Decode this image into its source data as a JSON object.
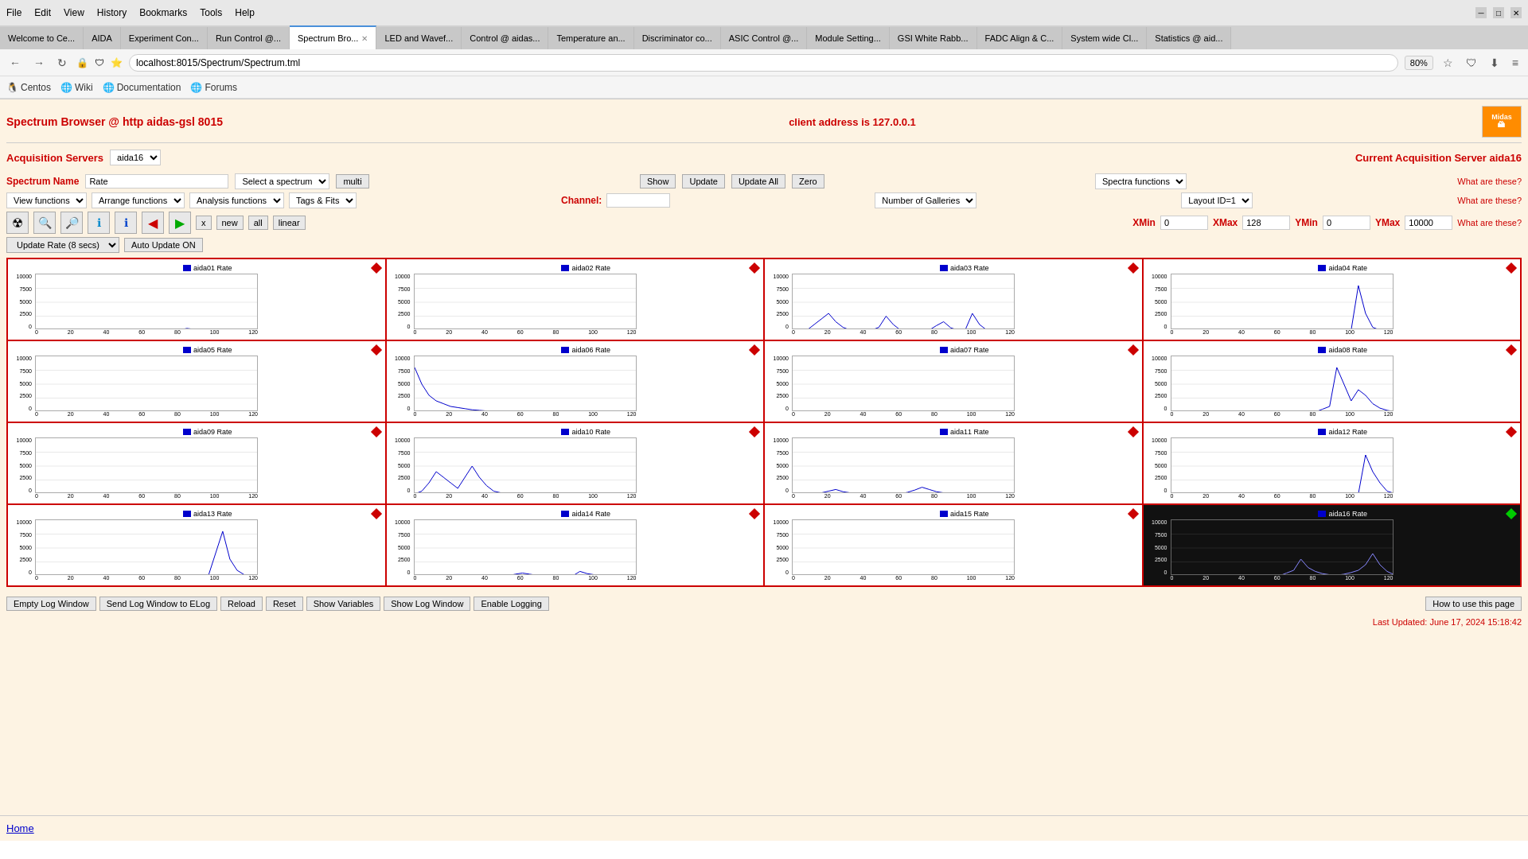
{
  "browser": {
    "title": "Spectrum Browser",
    "menu_items": [
      "File",
      "Edit",
      "View",
      "History",
      "Bookmarks",
      "Tools",
      "Help"
    ],
    "tabs": [
      {
        "label": "Welcome to Ce...",
        "active": false
      },
      {
        "label": "AIDA",
        "active": false
      },
      {
        "label": "Experiment Con...",
        "active": false
      },
      {
        "label": "Run Control @...",
        "active": false
      },
      {
        "label": "Spectrum Bro...",
        "active": true,
        "closeable": true
      },
      {
        "label": "LED and Wavef...",
        "active": false
      },
      {
        "label": "Control @ aidas...",
        "active": false
      },
      {
        "label": "Temperature an...",
        "active": false
      },
      {
        "label": "Discriminator co...",
        "active": false
      },
      {
        "label": "ASIC Control @...",
        "active": false
      },
      {
        "label": "Module Setting...",
        "active": false
      },
      {
        "label": "GSI White Rabb...",
        "active": false
      },
      {
        "label": "FADC Align & C...",
        "active": false
      },
      {
        "label": "System wide Cl...",
        "active": false
      },
      {
        "label": "Statistics @ aid...",
        "active": false
      }
    ],
    "url": "localhost:8015/Spectrum/Spectrum.tml",
    "zoom": "80%",
    "bookmarks": [
      "Centos",
      "Wiki",
      "Documentation",
      "Forums"
    ]
  },
  "page": {
    "title": "Spectrum Browser @ http aidas-gsl 8015",
    "client_address": "client address is 127.0.0.1"
  },
  "acquisition": {
    "label": "Acquisition Servers",
    "server_dropdown": "aida16",
    "current_label": "Current Acquisition Server aida16"
  },
  "controls": {
    "spectrum_name_label": "Spectrum Name",
    "spectrum_name_value": "Rate",
    "select_spectrum": "Select a spectrum",
    "multi_btn": "multi",
    "show_btn": "Show",
    "update_btn": "Update",
    "update_all_btn": "Update All",
    "zero_btn": "Zero",
    "spectra_functions": "Spectra functions",
    "what_these_1": "What are these?",
    "view_functions": "View functions",
    "arrange_functions": "Arrange functions",
    "analysis_functions": "Analysis functions",
    "tags_fits": "Tags & Fits",
    "channel_label": "Channel:",
    "channel_value": "",
    "number_of_galleries": "Number of Galleries",
    "layout_id": "Layout ID=1",
    "what_these_2": "What are these?",
    "xmin_label": "XMin",
    "xmin_value": "0",
    "xmax_label": "XMax",
    "xmax_value": "128",
    "ymin_label": "YMin",
    "ymin_value": "0",
    "ymax_label": "YMax",
    "ymax_value": "10000",
    "what_these_3": "What are these?",
    "x_btn": "x",
    "new_btn": "new",
    "all_btn": "all",
    "linear_btn": "linear",
    "update_rate_btn": "Update Rate (8 secs)",
    "auto_update_btn": "Auto Update ON"
  },
  "galleries": [
    {
      "id": "aida01",
      "label": "aida01 Rate",
      "active": true,
      "last": false
    },
    {
      "id": "aida02",
      "label": "aida02 Rate",
      "active": true,
      "last": false
    },
    {
      "id": "aida03",
      "label": "aida03 Rate",
      "active": true,
      "last": false
    },
    {
      "id": "aida04",
      "label": "aida04 Rate",
      "active": true,
      "last": false
    },
    {
      "id": "aida05",
      "label": "aida05 Rate",
      "active": true,
      "last": false
    },
    {
      "id": "aida06",
      "label": "aida06 Rate",
      "active": true,
      "last": false
    },
    {
      "id": "aida07",
      "label": "aida07 Rate",
      "active": true,
      "last": false
    },
    {
      "id": "aida08",
      "label": "aida08 Rate",
      "active": true,
      "last": false
    },
    {
      "id": "aida09",
      "label": "aida09 Rate",
      "active": true,
      "last": false
    },
    {
      "id": "aida10",
      "label": "aida10 Rate",
      "active": true,
      "last": false
    },
    {
      "id": "aida11",
      "label": "aida11 Rate",
      "active": true,
      "last": false
    },
    {
      "id": "aida12",
      "label": "aida12 Rate",
      "active": true,
      "last": false
    },
    {
      "id": "aida13",
      "label": "aida13 Rate",
      "active": true,
      "last": false
    },
    {
      "id": "aida14",
      "label": "aida14 Rate",
      "active": true,
      "last": false
    },
    {
      "id": "aida15",
      "label": "aida15 Rate",
      "active": true,
      "last": false
    },
    {
      "id": "aida16",
      "label": "aida16 Rate",
      "active": true,
      "last": true,
      "green_diamond": true
    }
  ],
  "bottom_buttons": [
    "Empty Log Window",
    "Send Log Window to ELog",
    "Reload",
    "Reset",
    "Show Variables",
    "Show Log Window",
    "Enable Logging"
  ],
  "bottom_right_btn": "How to use this page",
  "last_updated": "Last Updated: June 17, 2024 15:18:42",
  "footer": {
    "home_link": "Home"
  }
}
